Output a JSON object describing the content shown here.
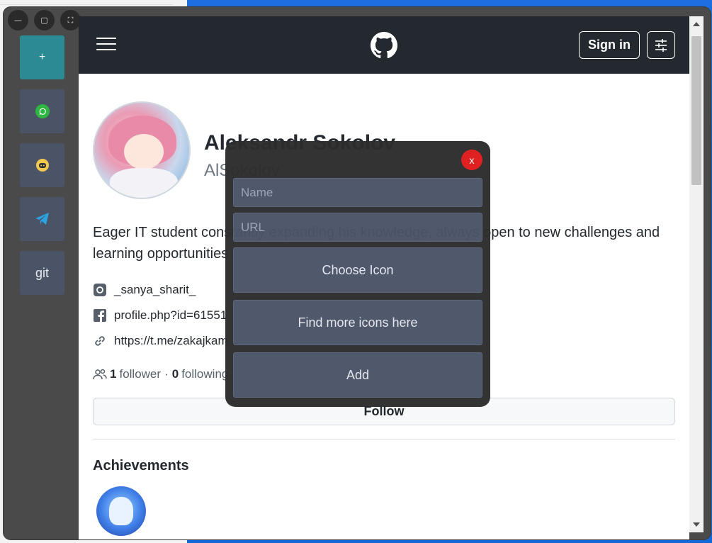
{
  "window": {
    "controls": [
      "—",
      "▢",
      "⛶"
    ]
  },
  "sidebar": {
    "items": [
      {
        "label": "+",
        "icon": "plus-icon"
      },
      {
        "label": "",
        "icon": "whatsapp-icon"
      },
      {
        "label": "",
        "icon": "discord-icon"
      },
      {
        "label": "",
        "icon": "telegram-icon"
      },
      {
        "label": "git",
        "icon": "git-text"
      }
    ]
  },
  "header": {
    "sign_in": "Sign in",
    "icons": [
      "menu-icon",
      "github-logo-icon",
      "sliders-icon"
    ]
  },
  "profile": {
    "full_name": "Aleksandr Sokolov",
    "username": "AlSokolov",
    "bio": "Eager IT student constantly expanding his knowledge, always open to new challenges and learning opportunities",
    "links": [
      {
        "icon": "instagram-icon",
        "text": "_sanya_sharit_"
      },
      {
        "icon": "facebook-icon",
        "text": "profile.php?id=61551"
      },
      {
        "icon": "link-icon",
        "text": "https://t.me/zakajkam..."
      }
    ],
    "followers_count": "1",
    "followers_label": "follower",
    "separator": "·",
    "following_count": "0",
    "following_label": "following",
    "follow_button": "Follow",
    "achievements_title": "Achievements"
  },
  "dialog": {
    "close_label": "x",
    "name_placeholder": "Name",
    "url_placeholder": "URL",
    "choose_icon": "Choose Icon",
    "find_more_icons": "Find more icons here",
    "add": "Add"
  }
}
